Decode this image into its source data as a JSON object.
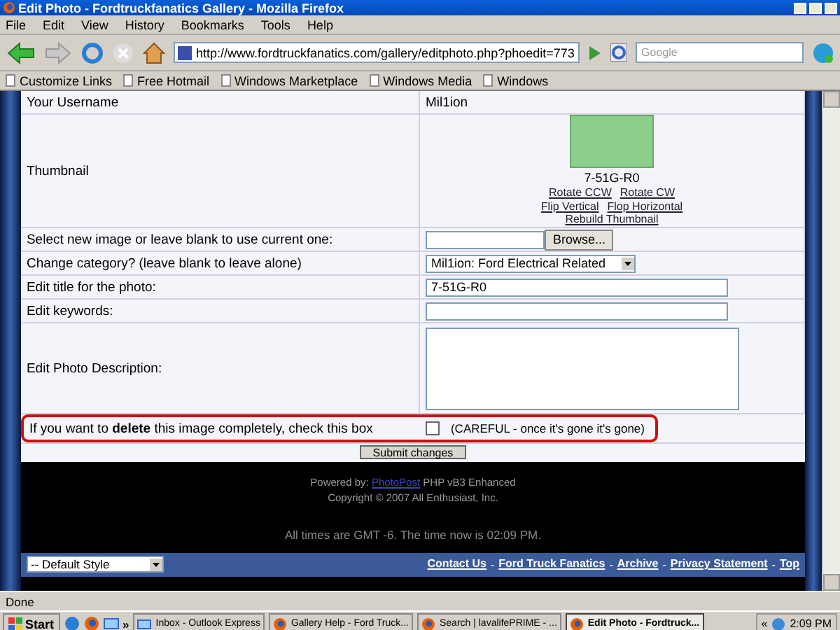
{
  "window": {
    "title": "Edit Photo - Fordtruckfanatics Gallery - Mozilla Firefox"
  },
  "menu": [
    "File",
    "Edit",
    "View",
    "History",
    "Bookmarks",
    "Tools",
    "Help"
  ],
  "address": {
    "value": "http://www.fordtruckfanatics.com/gallery/editphoto.php?phoedit=773"
  },
  "search": {
    "placeholder": "Google"
  },
  "bookmarks": [
    "Customize Links",
    "Free Hotmail",
    "Windows Marketplace",
    "Windows Media",
    "Windows"
  ],
  "form": {
    "rows": [
      {
        "kind": "text",
        "label": "Your Username",
        "value": "Mil1ion"
      },
      {
        "kind": "thumbnail",
        "label": "Thumbnail",
        "caption": "7-51G-R0",
        "links": [
          [
            "Rotate CCW",
            "Rotate CW"
          ],
          [
            "Flip Vertical",
            "Flop Horizontal"
          ],
          [
            "Rebuild Thumbnail"
          ]
        ]
      },
      {
        "kind": "file",
        "label": "Select new image or leave blank to use current one:",
        "button": "Browse..."
      },
      {
        "kind": "select",
        "label": "Change category? (leave blank to leave alone)",
        "value": "Mil1ion: Ford Electrical Related"
      },
      {
        "kind": "input",
        "label": "Edit title for the photo:",
        "value": "7-51G-R0"
      },
      {
        "kind": "input",
        "label": "Edit keywords:",
        "value": ""
      },
      {
        "kind": "textarea",
        "label": "Edit Photo Description:"
      },
      {
        "kind": "checkbox",
        "label": "If you want to **delete** this image completely, check this box",
        "note": "(CAREFUL - once it's gone it's gone)",
        "checked": false
      }
    ],
    "submit": "Submit changes"
  },
  "footer": {
    "powered_prefix": "Powered by:",
    "powered_link": "PhotoPost",
    "powered_suffix": "PHP vB3 Enhanced",
    "copyright": "Copyright © 2007 All Enthusiast, Inc.",
    "times": "All times are GMT -6. The time now is 02:09 PM."
  },
  "bottom_bar": {
    "style_select": "-- Default Style",
    "separator": "-",
    "links": [
      "Contact Us",
      "Ford Truck Fanatics",
      "Archive",
      "Privacy Statement",
      "Top"
    ]
  },
  "status_bar": "Done",
  "taskbar": {
    "start": "Start",
    "more": "»",
    "tasks": [
      {
        "label": "Inbox - Outlook Express",
        "selected": false
      },
      {
        "label": "Gallery Help - Ford Truck...",
        "selected": false
      },
      {
        "label": "Search | lavalifePRIME - ...",
        "selected": false
      },
      {
        "label": "Edit Photo - Fordtruck...",
        "selected": true
      }
    ],
    "tray_more": "«",
    "clock": "2:09 PM"
  }
}
